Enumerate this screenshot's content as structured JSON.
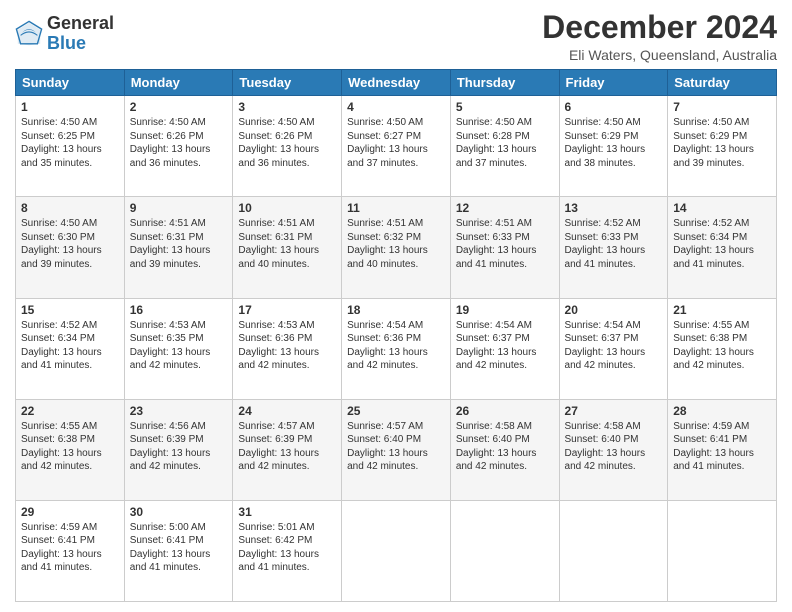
{
  "logo": {
    "general": "General",
    "blue": "Blue"
  },
  "header": {
    "title": "December 2024",
    "location": "Eli Waters, Queensland, Australia"
  },
  "days_of_week": [
    "Sunday",
    "Monday",
    "Tuesday",
    "Wednesday",
    "Thursday",
    "Friday",
    "Saturday"
  ],
  "weeks": [
    [
      {
        "day": "1",
        "sunrise": "4:50 AM",
        "sunset": "6:25 PM",
        "daylight": "13 hours and 35 minutes."
      },
      {
        "day": "2",
        "sunrise": "4:50 AM",
        "sunset": "6:26 PM",
        "daylight": "13 hours and 36 minutes."
      },
      {
        "day": "3",
        "sunrise": "4:50 AM",
        "sunset": "6:26 PM",
        "daylight": "13 hours and 36 minutes."
      },
      {
        "day": "4",
        "sunrise": "4:50 AM",
        "sunset": "6:27 PM",
        "daylight": "13 hours and 37 minutes."
      },
      {
        "day": "5",
        "sunrise": "4:50 AM",
        "sunset": "6:28 PM",
        "daylight": "13 hours and 37 minutes."
      },
      {
        "day": "6",
        "sunrise": "4:50 AM",
        "sunset": "6:29 PM",
        "daylight": "13 hours and 38 minutes."
      },
      {
        "day": "7",
        "sunrise": "4:50 AM",
        "sunset": "6:29 PM",
        "daylight": "13 hours and 39 minutes."
      }
    ],
    [
      {
        "day": "8",
        "sunrise": "4:50 AM",
        "sunset": "6:30 PM",
        "daylight": "13 hours and 39 minutes."
      },
      {
        "day": "9",
        "sunrise": "4:51 AM",
        "sunset": "6:31 PM",
        "daylight": "13 hours and 39 minutes."
      },
      {
        "day": "10",
        "sunrise": "4:51 AM",
        "sunset": "6:31 PM",
        "daylight": "13 hours and 40 minutes."
      },
      {
        "day": "11",
        "sunrise": "4:51 AM",
        "sunset": "6:32 PM",
        "daylight": "13 hours and 40 minutes."
      },
      {
        "day": "12",
        "sunrise": "4:51 AM",
        "sunset": "6:33 PM",
        "daylight": "13 hours and 41 minutes."
      },
      {
        "day": "13",
        "sunrise": "4:52 AM",
        "sunset": "6:33 PM",
        "daylight": "13 hours and 41 minutes."
      },
      {
        "day": "14",
        "sunrise": "4:52 AM",
        "sunset": "6:34 PM",
        "daylight": "13 hours and 41 minutes."
      }
    ],
    [
      {
        "day": "15",
        "sunrise": "4:52 AM",
        "sunset": "6:34 PM",
        "daylight": "13 hours and 41 minutes."
      },
      {
        "day": "16",
        "sunrise": "4:53 AM",
        "sunset": "6:35 PM",
        "daylight": "13 hours and 42 minutes."
      },
      {
        "day": "17",
        "sunrise": "4:53 AM",
        "sunset": "6:36 PM",
        "daylight": "13 hours and 42 minutes."
      },
      {
        "day": "18",
        "sunrise": "4:54 AM",
        "sunset": "6:36 PM",
        "daylight": "13 hours and 42 minutes."
      },
      {
        "day": "19",
        "sunrise": "4:54 AM",
        "sunset": "6:37 PM",
        "daylight": "13 hours and 42 minutes."
      },
      {
        "day": "20",
        "sunrise": "4:54 AM",
        "sunset": "6:37 PM",
        "daylight": "13 hours and 42 minutes."
      },
      {
        "day": "21",
        "sunrise": "4:55 AM",
        "sunset": "6:38 PM",
        "daylight": "13 hours and 42 minutes."
      }
    ],
    [
      {
        "day": "22",
        "sunrise": "4:55 AM",
        "sunset": "6:38 PM",
        "daylight": "13 hours and 42 minutes."
      },
      {
        "day": "23",
        "sunrise": "4:56 AM",
        "sunset": "6:39 PM",
        "daylight": "13 hours and 42 minutes."
      },
      {
        "day": "24",
        "sunrise": "4:57 AM",
        "sunset": "6:39 PM",
        "daylight": "13 hours and 42 minutes."
      },
      {
        "day": "25",
        "sunrise": "4:57 AM",
        "sunset": "6:40 PM",
        "daylight": "13 hours and 42 minutes."
      },
      {
        "day": "26",
        "sunrise": "4:58 AM",
        "sunset": "6:40 PM",
        "daylight": "13 hours and 42 minutes."
      },
      {
        "day": "27",
        "sunrise": "4:58 AM",
        "sunset": "6:40 PM",
        "daylight": "13 hours and 42 minutes."
      },
      {
        "day": "28",
        "sunrise": "4:59 AM",
        "sunset": "6:41 PM",
        "daylight": "13 hours and 41 minutes."
      }
    ],
    [
      {
        "day": "29",
        "sunrise": "4:59 AM",
        "sunset": "6:41 PM",
        "daylight": "13 hours and 41 minutes."
      },
      {
        "day": "30",
        "sunrise": "5:00 AM",
        "sunset": "6:41 PM",
        "daylight": "13 hours and 41 minutes."
      },
      {
        "day": "31",
        "sunrise": "5:01 AM",
        "sunset": "6:42 PM",
        "daylight": "13 hours and 41 minutes."
      },
      null,
      null,
      null,
      null
    ]
  ]
}
